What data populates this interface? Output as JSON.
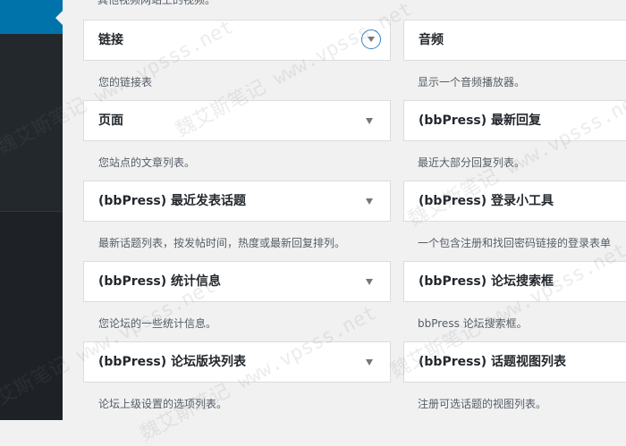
{
  "top_description": "其他视频网站上的视频。",
  "widgets_left": [
    {
      "title": "链接",
      "desc": "您的链接表"
    },
    {
      "title": "页面",
      "desc": "您站点的文章列表。"
    },
    {
      "title": "(bbPress) 最近发表话题",
      "desc": "最新话题列表，按发帖时间，热度或最新回复排列。"
    },
    {
      "title": "(bbPress) 统计信息",
      "desc": "您论坛的一些统计信息。"
    },
    {
      "title": "(bbPress) 论坛版块列表",
      "desc": "论坛上级设置的选项列表。"
    }
  ],
  "widgets_right": [
    {
      "title": "音频",
      "desc": "显示一个音频播放器。"
    },
    {
      "title": "(bbPress) 最新回复",
      "desc": "最近大部分回复列表。"
    },
    {
      "title": "(bbPress) 登录小工具",
      "desc": "一个包含注册和找回密码链接的登录表单"
    },
    {
      "title": "(bbPress) 论坛搜索框",
      "desc": "bbPress 论坛搜索框。"
    },
    {
      "title": "(bbPress) 话题视图列表",
      "desc": "注册可选话题的视图列表。"
    }
  ],
  "watermark": "魏艾斯笔记 www.vpsss.net",
  "colors": {
    "sidebar": "#23282d",
    "active": "#0073aa",
    "accent_circle": "#3582c4"
  },
  "icons": {
    "collapse": "chevron-down-icon"
  }
}
